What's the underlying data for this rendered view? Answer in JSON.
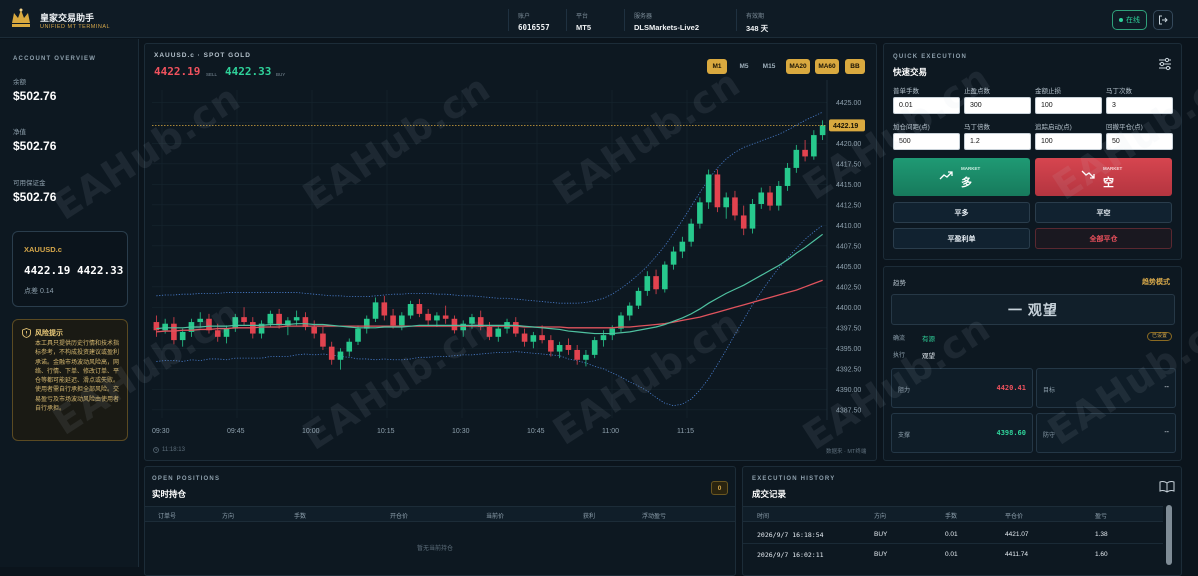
{
  "app": {
    "title": "皇家交易助手",
    "subtitle": "UNIFIED MT TERMINAL"
  },
  "header": {
    "account": {
      "label": "账户",
      "value": "6016557"
    },
    "platform": {
      "label": "平台",
      "value": "MT5"
    },
    "server": {
      "label": "服务器",
      "value": "DLSMarkets-Live2"
    },
    "validity": {
      "label": "有效期",
      "value": "348 天"
    },
    "online_label": "在线"
  },
  "account_overview": {
    "title": "ACCOUNT OVERVIEW",
    "balance": {
      "label": "余额",
      "value": "$502.76"
    },
    "equity": {
      "label": "净值",
      "value": "$502.76"
    },
    "free_margin": {
      "label": "可用保证金",
      "value": "$502.76"
    }
  },
  "symbol_card": {
    "symbol": "XAUUSD.c",
    "prices": "4422.19 4422.33",
    "spread": "点差 0.14"
  },
  "risk": {
    "title": "风险提示",
    "text": "本工具只提供历史行情和技术指标参考，不构成投资建议或盈利承诺。金融市场波动风险高，网络、行情、下单、修改订单、平仓等都可能延迟、滑点或失败。使用者需自行承担全部风险。交易盈亏及市场波动风险由使用者自行承担。"
  },
  "chart": {
    "title": "XAUUSD.c · SPOT GOLD",
    "bid": "4422.19",
    "bid_tag": "SELL",
    "ask": "4422.33",
    "ask_tag": "BUY",
    "timeframes": [
      {
        "label": "M1",
        "active": true
      },
      {
        "label": "M5",
        "active": false
      },
      {
        "label": "M15",
        "active": false
      },
      {
        "label": "MA20",
        "active": true
      },
      {
        "label": "MA60",
        "active": true
      },
      {
        "label": "BB",
        "active": true
      }
    ],
    "footer_time": "11:18:13",
    "footer_right": "数据来 · MT终端",
    "price_tag": "4422.19"
  },
  "chart_data": {
    "type": "candlestick",
    "title": "XAUUSD.c · SPOT GOLD",
    "y_ticks": [
      "4425.00",
      "4422.50",
      "4420.00",
      "4417.50",
      "4415.00",
      "4412.50",
      "4410.00",
      "4407.50",
      "4405.00",
      "4402.50",
      "4400.00",
      "4397.50",
      "4395.00",
      "4392.50",
      "4390.00",
      "4387.50"
    ],
    "ylim": [
      4386.5,
      4426.5
    ],
    "x_ticks": [
      "09:30",
      "09:45",
      "10:00",
      "10:15",
      "10:30",
      "10:45",
      "11:00",
      "11:15"
    ],
    "current_price": 4422.19,
    "candles": [
      [
        4398.2,
        4399.0,
        4396.4,
        4397.2
      ],
      [
        4397.2,
        4398.6,
        4396.8,
        4398.0
      ],
      [
        4398.0,
        4398.8,
        4395.5,
        4396.0
      ],
      [
        4396.0,
        4397.4,
        4395.2,
        4397.0
      ],
      [
        4397.0,
        4398.6,
        4396.4,
        4398.2
      ],
      [
        4398.2,
        4399.4,
        4397.6,
        4398.6
      ],
      [
        4398.6,
        4399.2,
        4396.8,
        4397.2
      ],
      [
        4397.2,
        4398.0,
        4395.8,
        4396.4
      ],
      [
        4396.4,
        4397.8,
        4395.6,
        4397.4
      ],
      [
        4397.4,
        4399.2,
        4397.0,
        4398.8
      ],
      [
        4398.8,
        4400.0,
        4397.8,
        4398.2
      ],
      [
        4398.2,
        4398.8,
        4396.2,
        4396.8
      ],
      [
        4396.8,
        4398.4,
        4396.2,
        4398.0
      ],
      [
        4398.0,
        4399.6,
        4397.6,
        4399.2
      ],
      [
        4399.2,
        4399.8,
        4397.4,
        4397.8
      ],
      [
        4397.8,
        4398.8,
        4396.6,
        4398.4
      ],
      [
        4398.4,
        4399.6,
        4397.8,
        4398.8
      ],
      [
        4398.8,
        4399.4,
        4397.2,
        4397.6
      ],
      [
        4397.6,
        4398.4,
        4396.2,
        4396.8
      ],
      [
        4396.8,
        4397.6,
        4394.8,
        4395.2
      ],
      [
        4395.2,
        4395.8,
        4393.0,
        4393.6
      ],
      [
        4393.6,
        4395.0,
        4392.4,
        4394.6
      ],
      [
        4394.6,
        4396.2,
        4394.0,
        4395.8
      ],
      [
        4395.8,
        4397.8,
        4395.4,
        4397.4
      ],
      [
        4397.4,
        4399.0,
        4396.8,
        4398.6
      ],
      [
        4398.6,
        4401.2,
        4398.2,
        4400.6
      ],
      [
        4400.6,
        4401.4,
        4398.4,
        4399.0
      ],
      [
        4399.0,
        4399.8,
        4397.4,
        4397.8
      ],
      [
        4397.8,
        4399.4,
        4397.2,
        4399.0
      ],
      [
        4399.0,
        4400.8,
        4398.6,
        4400.4
      ],
      [
        4400.4,
        4401.0,
        4398.8,
        4399.2
      ],
      [
        4399.2,
        4399.8,
        4397.8,
        4398.4
      ],
      [
        4398.4,
        4399.4,
        4397.6,
        4399.0
      ],
      [
        4399.0,
        4400.2,
        4398.0,
        4398.6
      ],
      [
        4398.6,
        4399.0,
        4396.8,
        4397.2
      ],
      [
        4397.2,
        4398.4,
        4396.4,
        4398.0
      ],
      [
        4398.0,
        4399.2,
        4397.4,
        4398.8
      ],
      [
        4398.8,
        4399.6,
        4397.2,
        4397.6
      ],
      [
        4397.6,
        4398.2,
        4396.0,
        4396.4
      ],
      [
        4396.4,
        4397.8,
        4395.8,
        4397.4
      ],
      [
        4397.4,
        4398.6,
        4396.8,
        4398.2
      ],
      [
        4398.2,
        4398.8,
        4396.4,
        4396.8
      ],
      [
        4396.8,
        4397.4,
        4395.2,
        4395.8
      ],
      [
        4395.8,
        4397.0,
        4395.0,
        4396.6
      ],
      [
        4396.6,
        4397.8,
        4395.6,
        4396.0
      ],
      [
        4396.0,
        4396.6,
        4394.0,
        4394.6
      ],
      [
        4394.6,
        4395.8,
        4393.8,
        4395.4
      ],
      [
        4395.4,
        4396.2,
        4394.2,
        4394.8
      ],
      [
        4394.8,
        4395.4,
        4393.0,
        4393.6
      ],
      [
        4393.6,
        4394.8,
        4392.8,
        4394.2
      ],
      [
        4394.2,
        4396.4,
        4393.8,
        4396.0
      ],
      [
        4396.0,
        4397.2,
        4395.2,
        4396.6
      ],
      [
        4396.6,
        4397.8,
        4396.0,
        4397.4
      ],
      [
        4397.4,
        4399.4,
        4397.0,
        4399.0
      ],
      [
        4399.0,
        4400.6,
        4398.4,
        4400.2
      ],
      [
        4400.2,
        4402.4,
        4399.8,
        4402.0
      ],
      [
        4402.0,
        4404.4,
        4401.4,
        4403.8
      ],
      [
        4403.8,
        4404.6,
        4401.6,
        4402.2
      ],
      [
        4402.2,
        4405.6,
        4401.8,
        4405.2
      ],
      [
        4405.2,
        4407.4,
        4404.6,
        4406.8
      ],
      [
        4406.8,
        4408.6,
        4406.0,
        4408.0
      ],
      [
        4408.0,
        4410.8,
        4407.4,
        4410.2
      ],
      [
        4410.2,
        4413.4,
        4409.6,
        4412.8
      ],
      [
        4412.8,
        4416.8,
        4412.0,
        4416.2
      ],
      [
        4416.2,
        4416.8,
        4411.6,
        4412.2
      ],
      [
        4412.2,
        4414.0,
        4410.8,
        4413.4
      ],
      [
        4413.4,
        4414.2,
        4410.6,
        4411.2
      ],
      [
        4411.2,
        4412.4,
        4408.8,
        4409.6
      ],
      [
        4409.6,
        4413.2,
        4409.0,
        4412.6
      ],
      [
        4412.6,
        4414.6,
        4412.0,
        4414.0
      ],
      [
        4414.0,
        4414.8,
        4411.8,
        4412.4
      ],
      [
        4412.4,
        4415.4,
        4411.8,
        4414.8
      ],
      [
        4414.8,
        4417.6,
        4414.2,
        4417.0
      ],
      [
        4417.0,
        4419.8,
        4416.4,
        4419.2
      ],
      [
        4419.2,
        4420.4,
        4417.8,
        4418.4
      ],
      [
        4418.4,
        4421.6,
        4418.0,
        4421.0
      ],
      [
        4421.0,
        4422.8,
        4420.4,
        4422.19
      ]
    ],
    "ma20": [
      4397.4,
      4397.5,
      4397.5,
      4397.5,
      4397.6,
      4397.6,
      4397.7,
      4397.7,
      4397.7,
      4397.8,
      4397.8,
      4397.8,
      4397.8,
      4397.9,
      4397.9,
      4397.9,
      4398.0,
      4398.0,
      4397.9,
      4397.9,
      4397.8,
      4397.7,
      4397.6,
      4397.5,
      4397.5,
      4397.5,
      4397.6,
      4397.6,
      4397.6,
      4397.7,
      4397.8,
      4397.8,
      4397.8,
      4397.8,
      4397.8,
      4397.8,
      4397.8,
      4397.8,
      4397.8,
      4397.8,
      4397.8,
      4397.8,
      4397.7,
      4397.6,
      4397.5,
      4397.4,
      4397.3,
      4397.1,
      4397.0,
      4396.9,
      4396.8,
      4396.8,
      4396.8,
      4396.9,
      4397.0,
      4397.2,
      4397.4,
      4397.6,
      4397.9,
      4398.3,
      4398.7,
      4399.2,
      4399.8,
      4400.5,
      4401.1,
      4401.7,
      4402.2,
      4402.7,
      4403.3,
      4403.9,
      4404.5,
      4405.1,
      4405.8,
      4406.6,
      4407.3,
      4408.1,
      4408.9
    ],
    "ma60": [
      4397.0,
      4397.1,
      4397.1,
      4397.2,
      4397.2,
      4397.3,
      4397.3,
      4397.4,
      4397.4,
      4397.5,
      4397.5,
      4397.5,
      4397.6,
      4397.6,
      4397.6,
      4397.7,
      4397.7,
      4397.7,
      4397.7,
      4397.7,
      4397.7,
      4397.7,
      4397.7,
      4397.7,
      4397.7,
      4397.7,
      4397.7,
      4397.7,
      4397.7,
      4397.7,
      4397.7,
      4397.7,
      4397.7,
      4397.7,
      4397.7,
      4397.7,
      4397.7,
      4397.7,
      4397.7,
      4397.7,
      4397.7,
      4397.7,
      4397.6,
      4397.6,
      4397.6,
      4397.6,
      4397.6,
      4397.5,
      4397.5,
      4397.5,
      4397.5,
      4397.5,
      4397.5,
      4397.6,
      4397.6,
      4397.7,
      4397.8,
      4397.9,
      4398.0,
      4398.2,
      4398.4,
      4398.6,
      4398.8,
      4399.1,
      4399.4,
      4399.7,
      4400.0,
      4400.3,
      4400.6,
      4400.9,
      4401.2,
      4401.5,
      4401.8,
      4402.1,
      4402.5,
      4402.9,
      4403.3
    ],
    "bb_upper": [
      4401.4,
      4401.5,
      4401.5,
      4401.6,
      4401.6,
      4401.7,
      4401.7,
      4401.7,
      4401.8,
      4401.8,
      4401.8,
      4401.8,
      4401.8,
      4401.8,
      4401.8,
      4401.8,
      4401.8,
      4401.7,
      4401.6,
      4401.5,
      4401.4,
      4401.4,
      4401.3,
      4401.3,
      4401.3,
      4401.4,
      4401.5,
      4401.6,
      4401.6,
      4401.7,
      4401.7,
      4401.7,
      4401.6,
      4401.6,
      4401.5,
      4401.4,
      4401.4,
      4401.3,
      4401.2,
      4401.1,
      4401.1,
      4401.0,
      4400.9,
      4400.8,
      4400.7,
      4400.6,
      4400.5,
      4400.5,
      4400.5,
      4400.6,
      4400.8,
      4401.1,
      4401.6,
      4402.3,
      4403.1,
      4404.0,
      4405.0,
      4406.2,
      4407.5,
      4409.0,
      4410.6,
      4412.3,
      4414.0,
      4415.6,
      4417.0,
      4418.1,
      4418.9,
      4419.5,
      4419.9,
      4420.3,
      4420.7,
      4421.1,
      4421.6,
      4422.2,
      4422.8,
      4423.3,
      4423.8
    ],
    "bb_lower": [
      4393.4,
      4393.5,
      4393.5,
      4393.4,
      4393.6,
      4393.5,
      4393.7,
      4393.7,
      4393.6,
      4393.8,
      4393.8,
      4393.8,
      4393.8,
      4394.0,
      4394.0,
      4394.0,
      4394.2,
      4394.3,
      4394.2,
      4394.3,
      4394.2,
      4394.0,
      4393.9,
      4393.7,
      4393.7,
      4393.6,
      4393.7,
      4393.6,
      4393.6,
      4393.7,
      4393.9,
      4393.9,
      4394.0,
      4394.0,
      4394.1,
      4394.2,
      4394.2,
      4394.3,
      4394.4,
      4394.5,
      4394.5,
      4394.6,
      4394.5,
      4394.4,
      4394.3,
      4394.2,
      4394.1,
      4393.7,
      4393.5,
      4393.2,
      4392.8,
      4392.5,
      4392.0,
      4391.5,
      4390.9,
      4390.4,
      4389.8,
      4389.0,
      4388.3,
      4388.0,
      4388.2,
      4388.8,
      4389.9,
      4391.3,
      4393.0,
      4394.8,
      4396.7,
      4398.5,
      4400.3,
      4401.9,
      4403.4,
      4404.8,
      4406.0,
      4407.2,
      4408.3,
      4409.2,
      4410.0
    ]
  },
  "quick_exec": {
    "title": "QUICK EXECUTION",
    "subtitle": "快速交易",
    "fields": [
      {
        "label": "普单手数",
        "value": "0.01"
      },
      {
        "label": "止盈点数",
        "value": "300"
      },
      {
        "label": "金额止损",
        "value": "100"
      },
      {
        "label": "马丁次数",
        "value": "3"
      },
      {
        "label": "加仓间距(点)",
        "value": "500"
      },
      {
        "label": "马丁倍数",
        "value": "1.2"
      },
      {
        "label": "追踪启动(点)",
        "value": "100"
      },
      {
        "label": "回撤平仓(点)",
        "value": "50"
      }
    ],
    "buy": {
      "tag": "MARKET",
      "label": "多"
    },
    "sell": {
      "tag": "MARKET",
      "label": "空"
    },
    "close_long": "平多",
    "close_short": "平空",
    "close_profit": "平盈利单",
    "close_all": "全部平仓"
  },
  "trend": {
    "label": "趋势",
    "mode": "趋势模式",
    "status": "一 观望",
    "filter_label": "确流",
    "filter_value": "有源",
    "filter_badge": "已设置",
    "exec_label": "执行",
    "exec_value": "观望",
    "resistance": {
      "label": "阻力",
      "value": "4420.41"
    },
    "support": {
      "label": "支撑",
      "value": "4398.60"
    },
    "target_label": "目标",
    "target_value": "--",
    "stop_label": "防守",
    "stop_value": "--"
  },
  "positions": {
    "title_en": "OPEN POSITIONS",
    "title_cn": "实时持仓",
    "count": "0",
    "columns": [
      "订单号",
      "方向",
      "手数",
      "开仓价",
      "当前价",
      "获利",
      "浮动盈亏"
    ],
    "empty": "暂无当前持仓"
  },
  "history": {
    "title_en": "EXECUTION HISTORY",
    "title_cn": "成交记录",
    "columns": [
      "时间",
      "方向",
      "手数",
      "平仓价",
      "盈亏"
    ],
    "rows": [
      {
        "time": "2026/9/7 16:18:54",
        "dir": "BUY",
        "lots": "0.01",
        "price": "4421.07",
        "pl": "1.38"
      },
      {
        "time": "2026/9/7 16:02:11",
        "dir": "BUY",
        "lots": "0.01",
        "price": "4411.74",
        "pl": "1.60"
      }
    ]
  },
  "watermark": "EAHub.cn"
}
